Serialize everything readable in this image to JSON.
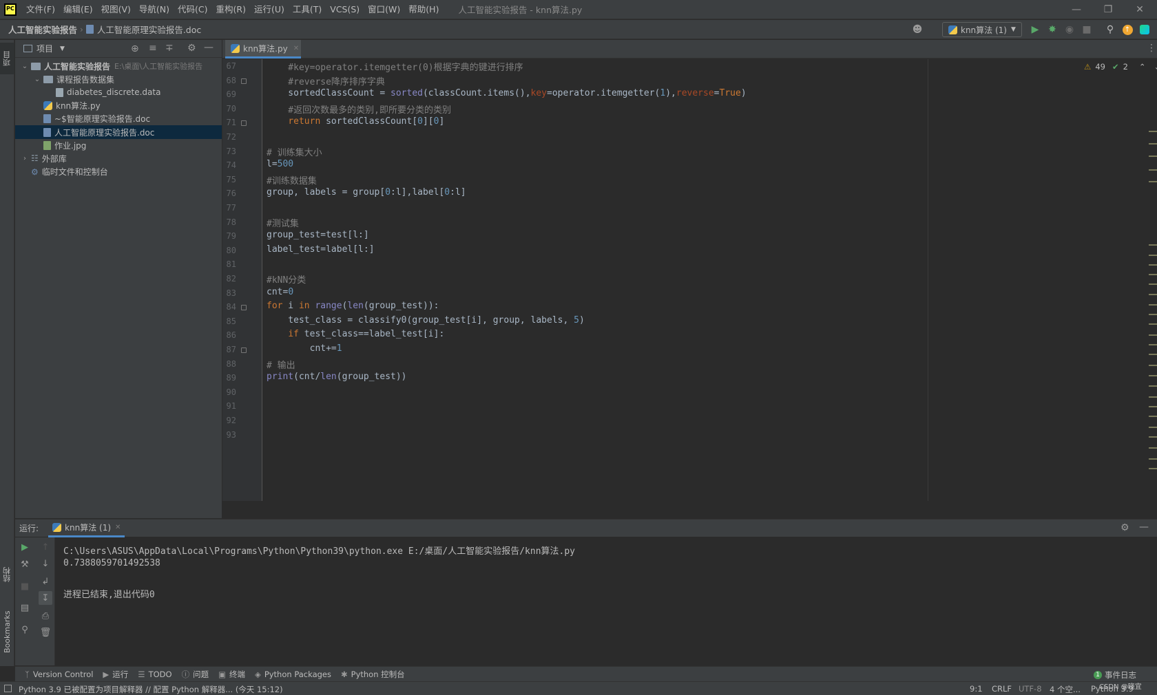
{
  "app": {
    "window_title": "人工智能实验报告 - knn算法.py",
    "logo_text": "PC"
  },
  "menu": [
    "文件(F)",
    "编辑(E)",
    "视图(V)",
    "导航(N)",
    "代码(C)",
    "重构(R)",
    "运行(U)",
    "工具(T)",
    "VCS(S)",
    "窗口(W)",
    "帮助(H)"
  ],
  "breadcrumb": {
    "project": "人工智能实验报告",
    "file": "人工智能原理实验报告.doc"
  },
  "run_config": "knn算法 (1)",
  "left_strip": {
    "project_tab": "项目",
    "structure_tab": "结构",
    "bookmarks_tab": "Bookmarks"
  },
  "project_panel": {
    "title": "项目",
    "tree": [
      {
        "label": "人工智能实验报告",
        "path": "E:\\桌面\\人工智能实验报告",
        "kind": "folder",
        "level": 0,
        "expanded": true
      },
      {
        "label": "课程报告数据集",
        "kind": "folder",
        "level": 1,
        "expanded": true
      },
      {
        "label": "diabetes_discrete.data",
        "kind": "file",
        "level": 2
      },
      {
        "label": "knn算法.py",
        "kind": "py",
        "level": 1
      },
      {
        "label": "~$智能原理实验报告.doc",
        "kind": "doc",
        "level": 1
      },
      {
        "label": "人工智能原理实验报告.doc",
        "kind": "doc",
        "level": 1,
        "selected": true
      },
      {
        "label": "作业.jpg",
        "kind": "img",
        "level": 1
      },
      {
        "label": "外部库",
        "kind": "lib",
        "level": 0,
        "expanded": false
      },
      {
        "label": "临时文件和控制台",
        "kind": "scratch",
        "level": 0
      }
    ]
  },
  "editor": {
    "tab": "knn算法.py",
    "inspection": {
      "warnings": "49",
      "weak": "2"
    },
    "line_numbers": [
      "67",
      "68",
      "69",
      "70",
      "71",
      "72",
      "73",
      "74",
      "75",
      "76",
      "77",
      "78",
      "79",
      "80",
      "81",
      "82",
      "83",
      "84",
      "85",
      "86",
      "87",
      "88",
      "89",
      "90",
      "91",
      "92",
      "93"
    ],
    "lines": [
      "    #key=operator.itemgetter(0)根据字典的键进行排序",
      "    #reverse降序排序字典",
      "    sortedClassCount = sorted(classCount.items(),key=operator.itemgetter(1),reverse=True)",
      "    #返回次数最多的类别,即所要分类的类别",
      "    return sortedClassCount[0][0]",
      "",
      "# 训练集大小",
      "l=500",
      "#训练数据集",
      "group, labels = group[0:l],label[0:l]",
      "",
      "#测试集",
      "group_test=test[l:]",
      "label_test=label[l:]",
      "",
      "#kNN分类",
      "cnt=0",
      "for i in range(len(group_test)):",
      "    test_class = classify0(group_test[i], group, labels, 5)",
      "    if test_class==label_test[i]:",
      "        cnt+=1",
      "# 输出",
      "print(cnt/len(group_test))",
      "",
      "",
      "",
      ""
    ]
  },
  "run_panel": {
    "label": "运行:",
    "tab": "knn算法 (1)",
    "output": [
      "C:\\Users\\ASUS\\AppData\\Local\\Programs\\Python\\Python39\\python.exe E:/桌面/人工智能实验报告/knn算法.py",
      "0.7388059701492538",
      "",
      "进程已结束,退出代码0"
    ]
  },
  "tool_windows": [
    "Version Control",
    "运行",
    "TODO",
    "问题",
    "终端",
    "Python Packages",
    "Python 控制台"
  ],
  "event_log": {
    "count": "1",
    "label": "事件日志"
  },
  "status": {
    "message": "Python 3.9 已被配置为项目解释器 // 配置 Python 解释器... (今天 15:12)",
    "position": "9:1",
    "line_sep": "CRLF",
    "encoding": "UTF-8",
    "indent": "4 个空...",
    "interpreter": "Python 3.9",
    "watermark": "CSDN @晓宜"
  },
  "colors": {
    "selection": "#0d293e",
    "accent": "#4a88c7",
    "keyword": "#cc7832",
    "number": "#6897bb",
    "comment": "#808080"
  }
}
